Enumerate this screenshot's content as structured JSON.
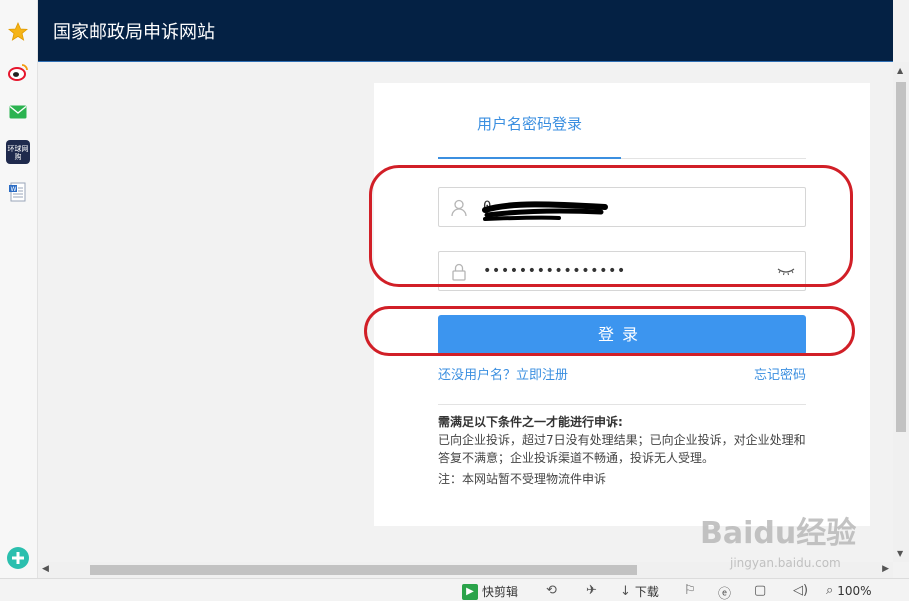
{
  "site": {
    "title": "国家邮政局申诉网站"
  },
  "sidebar": {
    "items": [
      "star-icon",
      "weibo-icon",
      "mail-icon",
      "news-icon",
      "document-icon",
      "add-icon"
    ],
    "news_label": "环球网购"
  },
  "login": {
    "tab_label": "用户名密码登录",
    "username_value": "0",
    "password_value": "••••••••••••••••",
    "button_label": "登录",
    "register_link": "还没用户名？立即注册",
    "forgot_link": "忘记密码"
  },
  "notice": {
    "title": "需满足以下条件之一才能进行申诉:",
    "body": "已向企业投诉，超过7日没有处理结果；已向企业投诉，对企业处理和答复不满意；企业投诉渠道不畅通，投诉无人受理。",
    "note": "注：本网站暂不受理物流件申诉"
  },
  "statusbar": {
    "quick_edit": "快剪辑",
    "download": "下载",
    "zoom": "100%"
  },
  "watermark": {
    "main": "Baidu经验",
    "sub": "jingyan.baidu.com"
  },
  "colors": {
    "header": "#042144",
    "accent": "#3c95ef",
    "annotation": "#d11f27"
  }
}
